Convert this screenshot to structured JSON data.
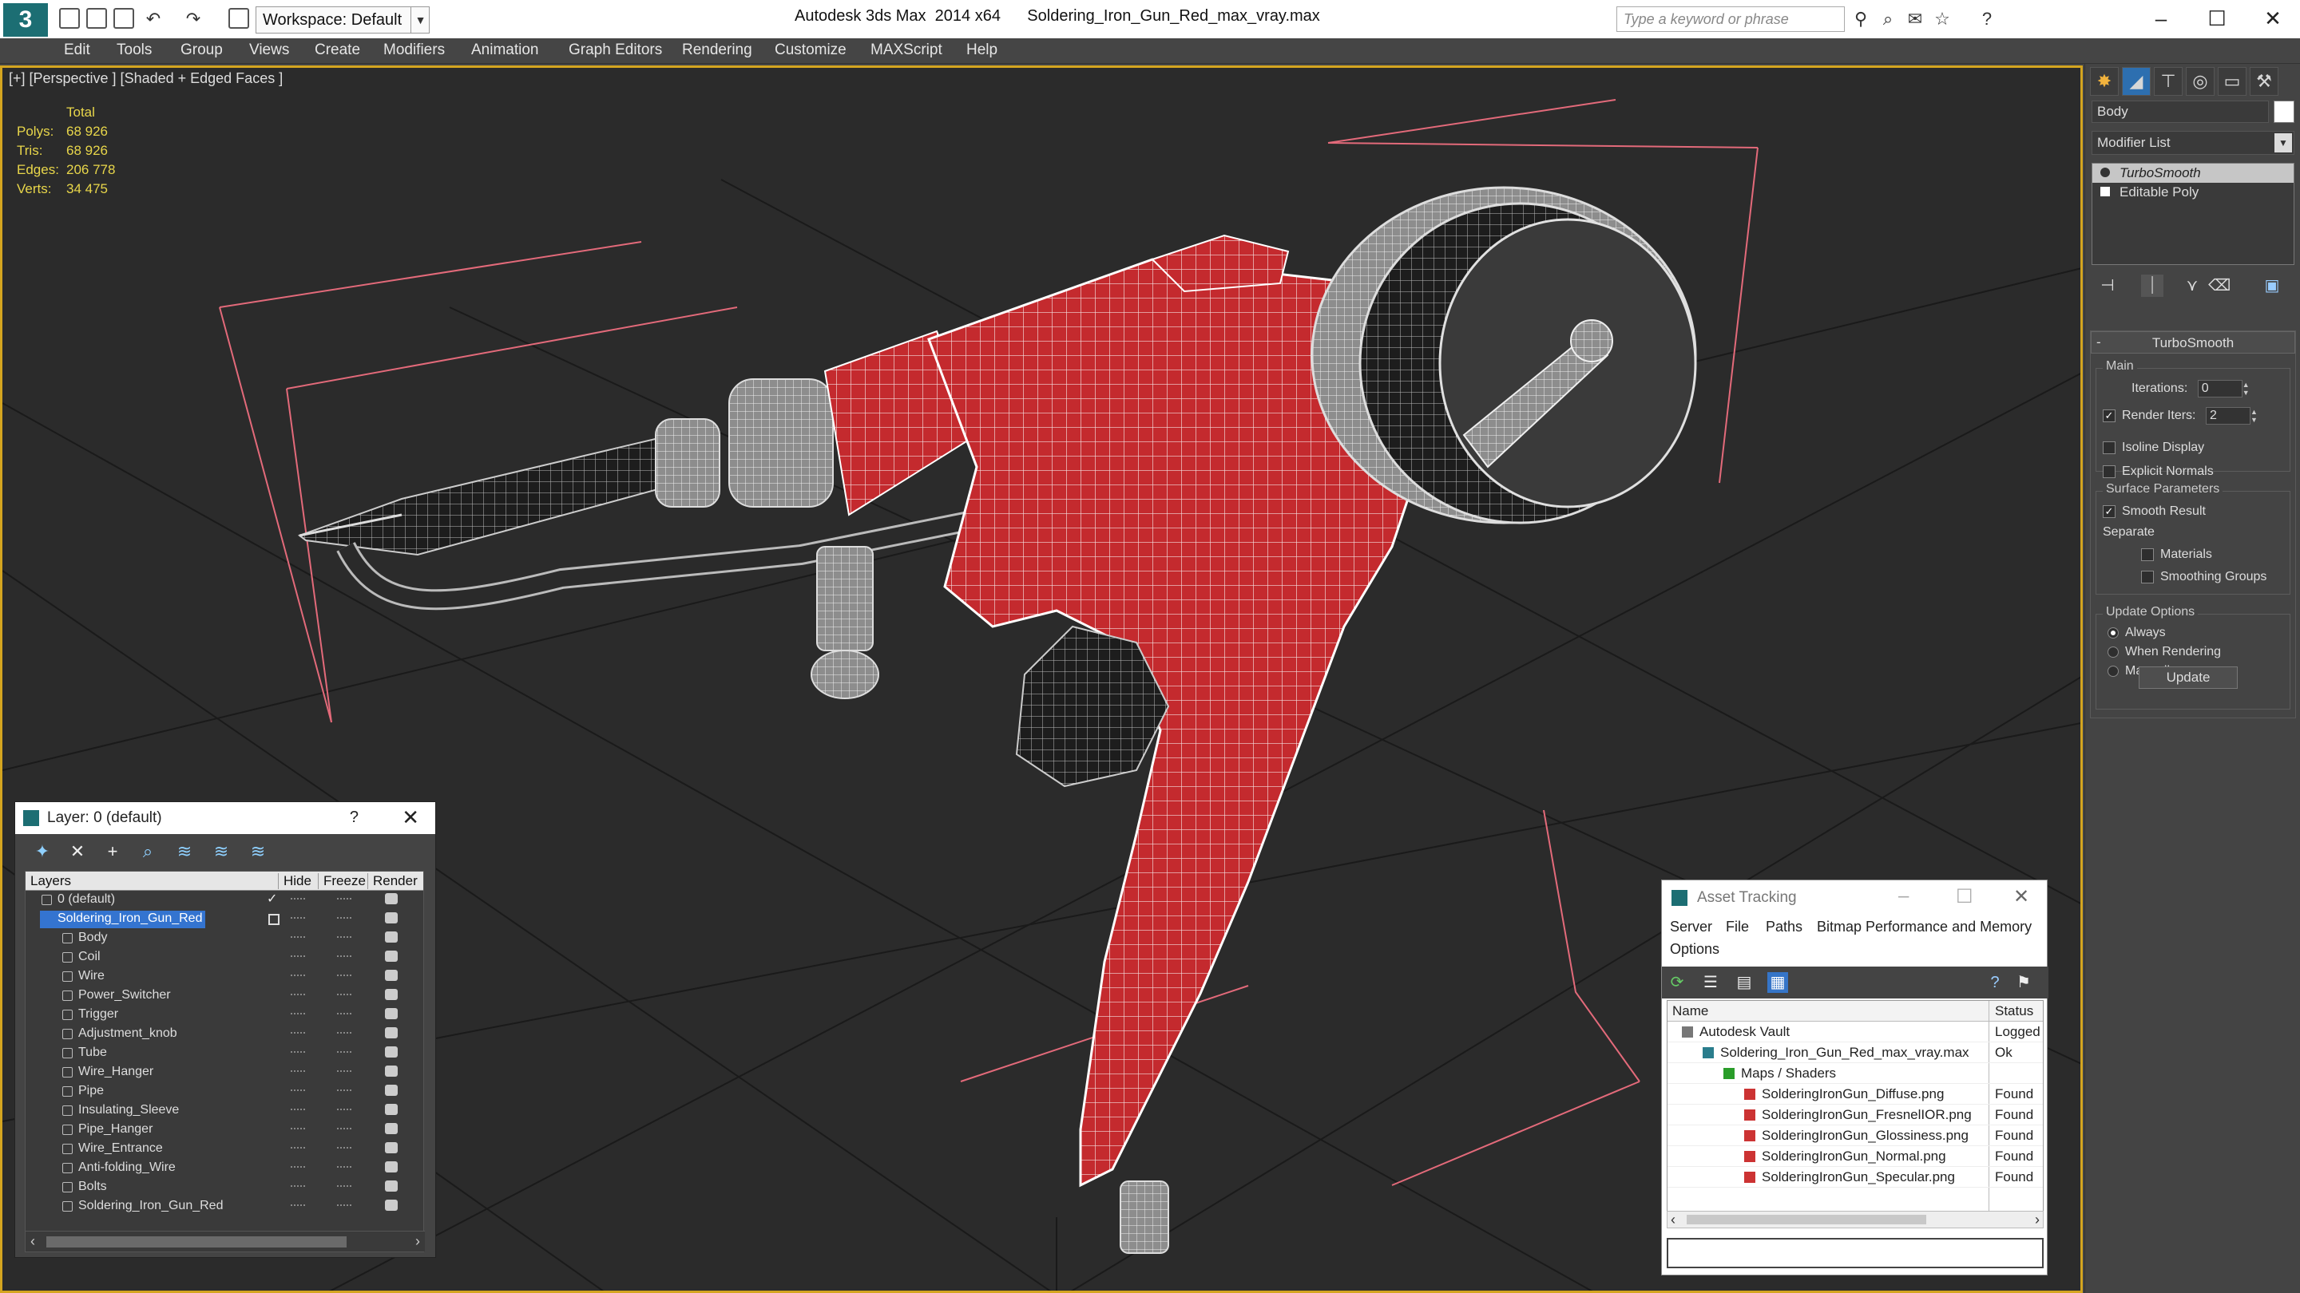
{
  "titlebar": {
    "workspace": "Workspace: Default",
    "app_name": "Autodesk 3ds Max  2014 x64",
    "file_name": "Soldering_Iron_Gun_Red_max_vray.max",
    "search_placeholder": "Type a keyword or phrase"
  },
  "menu": [
    "Edit",
    "Tools",
    "Group",
    "Views",
    "Create",
    "Modifiers",
    "Animation",
    "Graph Editors",
    "Rendering",
    "Customize",
    "MAXScript",
    "Help"
  ],
  "viewport": {
    "label": "[+] [Perspective ] [Shaded + Edged Faces ]",
    "stats": {
      "header": "Total",
      "polys_label": "Polys:",
      "polys": "68 926",
      "tris_label": "Tris:",
      "tris": "68 926",
      "edges_label": "Edges:",
      "edges": "206 778",
      "verts_label": "Verts:",
      "verts": "34 475"
    },
    "object_color": "#c42a2e"
  },
  "command_panel": {
    "object_name": "Body",
    "modifier_list": "Modifier List",
    "stack": [
      "TurboSmooth",
      "Editable Poly"
    ],
    "rollout_title": "TurboSmooth",
    "main_group": "Main",
    "iterations_label": "Iterations:",
    "iterations": "0",
    "render_iters_label": "Render Iters:",
    "render_iters": "2",
    "isoline": "Isoline Display",
    "explicit_normals": "Explicit Normals",
    "surface_group": "Surface Parameters",
    "smooth_result": "Smooth Result",
    "separate": "Separate",
    "materials": "Materials",
    "smoothing_groups": "Smoothing Groups",
    "update_group": "Update Options",
    "always": "Always",
    "when_rendering": "When Rendering",
    "manually": "Manually",
    "update_button": "Update"
  },
  "layer_dialog": {
    "title": "Layer: 0 (default)",
    "help": "?",
    "columns": [
      "Layers",
      "Hide",
      "Freeze",
      "Render"
    ],
    "layers": [
      {
        "name": "0 (default)",
        "level": 1,
        "kind": "layer"
      },
      {
        "name": "Soldering_Iron_Gun_Red",
        "level": 1,
        "kind": "layer",
        "selected": true
      },
      {
        "name": "Body",
        "level": 2,
        "kind": "object"
      },
      {
        "name": "Coil",
        "level": 2,
        "kind": "object"
      },
      {
        "name": "Wire",
        "level": 2,
        "kind": "object"
      },
      {
        "name": "Power_Switcher",
        "level": 2,
        "kind": "object"
      },
      {
        "name": "Trigger",
        "level": 2,
        "kind": "object"
      },
      {
        "name": "Adjustment_knob",
        "level": 2,
        "kind": "object"
      },
      {
        "name": "Tube",
        "level": 2,
        "kind": "object"
      },
      {
        "name": "Wire_Hanger",
        "level": 2,
        "kind": "object"
      },
      {
        "name": "Pipe",
        "level": 2,
        "kind": "object"
      },
      {
        "name": "Insulating_Sleeve",
        "level": 2,
        "kind": "object"
      },
      {
        "name": "Pipe_Hanger",
        "level": 2,
        "kind": "object"
      },
      {
        "name": "Wire_Entrance",
        "level": 2,
        "kind": "object"
      },
      {
        "name": "Anti-folding_Wire",
        "level": 2,
        "kind": "object"
      },
      {
        "name": "Bolts",
        "level": 2,
        "kind": "object"
      },
      {
        "name": "Soldering_Iron_Gun_Red",
        "level": 2,
        "kind": "object"
      }
    ]
  },
  "asset_dialog": {
    "title": "Asset Tracking",
    "menu_row1": [
      "Server",
      "File",
      "Paths",
      "Bitmap Performance and Memory"
    ],
    "menu_row2": [
      "Options"
    ],
    "columns": [
      "Name",
      "Status"
    ],
    "rows": [
      {
        "name": "Autodesk Vault",
        "status": "Logged",
        "indent": 0,
        "icon": "vault"
      },
      {
        "name": "Soldering_Iron_Gun_Red_max_vray.max",
        "status": "Ok",
        "indent": 1,
        "icon": "max"
      },
      {
        "name": "Maps / Shaders",
        "status": "",
        "indent": 2,
        "icon": "maps"
      },
      {
        "name": "SolderingIronGun_Diffuse.png",
        "status": "Found",
        "indent": 3,
        "icon": "png"
      },
      {
        "name": "SolderingIronGun_FresnelIOR.png",
        "status": "Found",
        "indent": 3,
        "icon": "png"
      },
      {
        "name": "SolderingIronGun_Glossiness.png",
        "status": "Found",
        "indent": 3,
        "icon": "png"
      },
      {
        "name": "SolderingIronGun_Normal.png",
        "status": "Found",
        "indent": 3,
        "icon": "png"
      },
      {
        "name": "SolderingIronGun_Specular.png",
        "status": "Found",
        "indent": 3,
        "icon": "png"
      }
    ]
  }
}
